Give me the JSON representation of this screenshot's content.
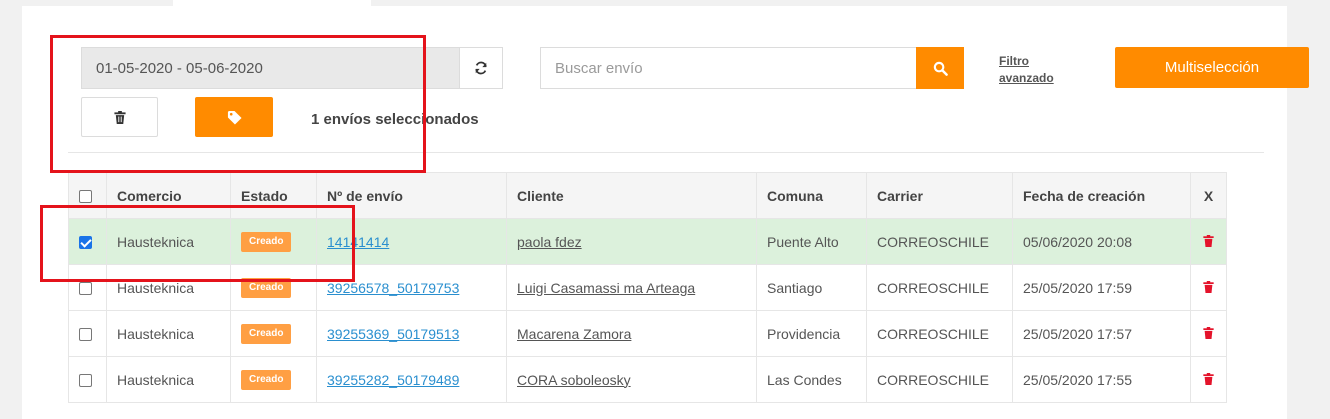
{
  "toolbar": {
    "date_range": "01-05-2020 - 05-06-2020",
    "search_placeholder": "Buscar envío",
    "filter_line1": "Filtro",
    "filter_line2": "avanzado",
    "multiselect_label": "Multiselección",
    "selected_count_text": "1 envíos seleccionados"
  },
  "colors": {
    "accent": "#ff8b00",
    "badge": "#ff9f43",
    "link": "#2a8fcf",
    "selected_row": "#dcf1dc",
    "highlight": "#e4131b",
    "delete": "#e4132b"
  },
  "icons": [
    "refresh-icon",
    "search-icon",
    "trash-icon",
    "tag-icon",
    "delete-icon"
  ],
  "table": {
    "headers": [
      "Comercio",
      "Estado",
      "Nº de envío",
      "Cliente",
      "Comuna",
      "Carrier",
      "Fecha de creación",
      "X"
    ],
    "rows": [
      {
        "checked": true,
        "comercio": "Hausteknica",
        "estado": "Creado",
        "envio": "14141414",
        "cliente": "paola fdez",
        "comuna": "Puente Alto",
        "carrier": "CORREOSCHILE",
        "fecha": "05/06/2020 20:08"
      },
      {
        "checked": false,
        "comercio": "Hausteknica",
        "estado": "Creado",
        "envio": "39256578_50179753",
        "cliente": "Luigi Casamassi ma Arteaga",
        "comuna": "Santiago",
        "carrier": "CORREOSCHILE",
        "fecha": "25/05/2020 17:59"
      },
      {
        "checked": false,
        "comercio": "Hausteknica",
        "estado": "Creado",
        "envio": "39255369_50179513",
        "cliente": "Macarena Zamora",
        "comuna": "Providencia",
        "carrier": "CORREOSCHILE",
        "fecha": "25/05/2020 17:57"
      },
      {
        "checked": false,
        "comercio": "Hausteknica",
        "estado": "Creado",
        "envio": "39255282_50179489",
        "cliente": "CORA soboleosky",
        "comuna": "Las Condes",
        "carrier": "CORREOSCHILE",
        "fecha": "25/05/2020 17:55"
      }
    ]
  }
}
